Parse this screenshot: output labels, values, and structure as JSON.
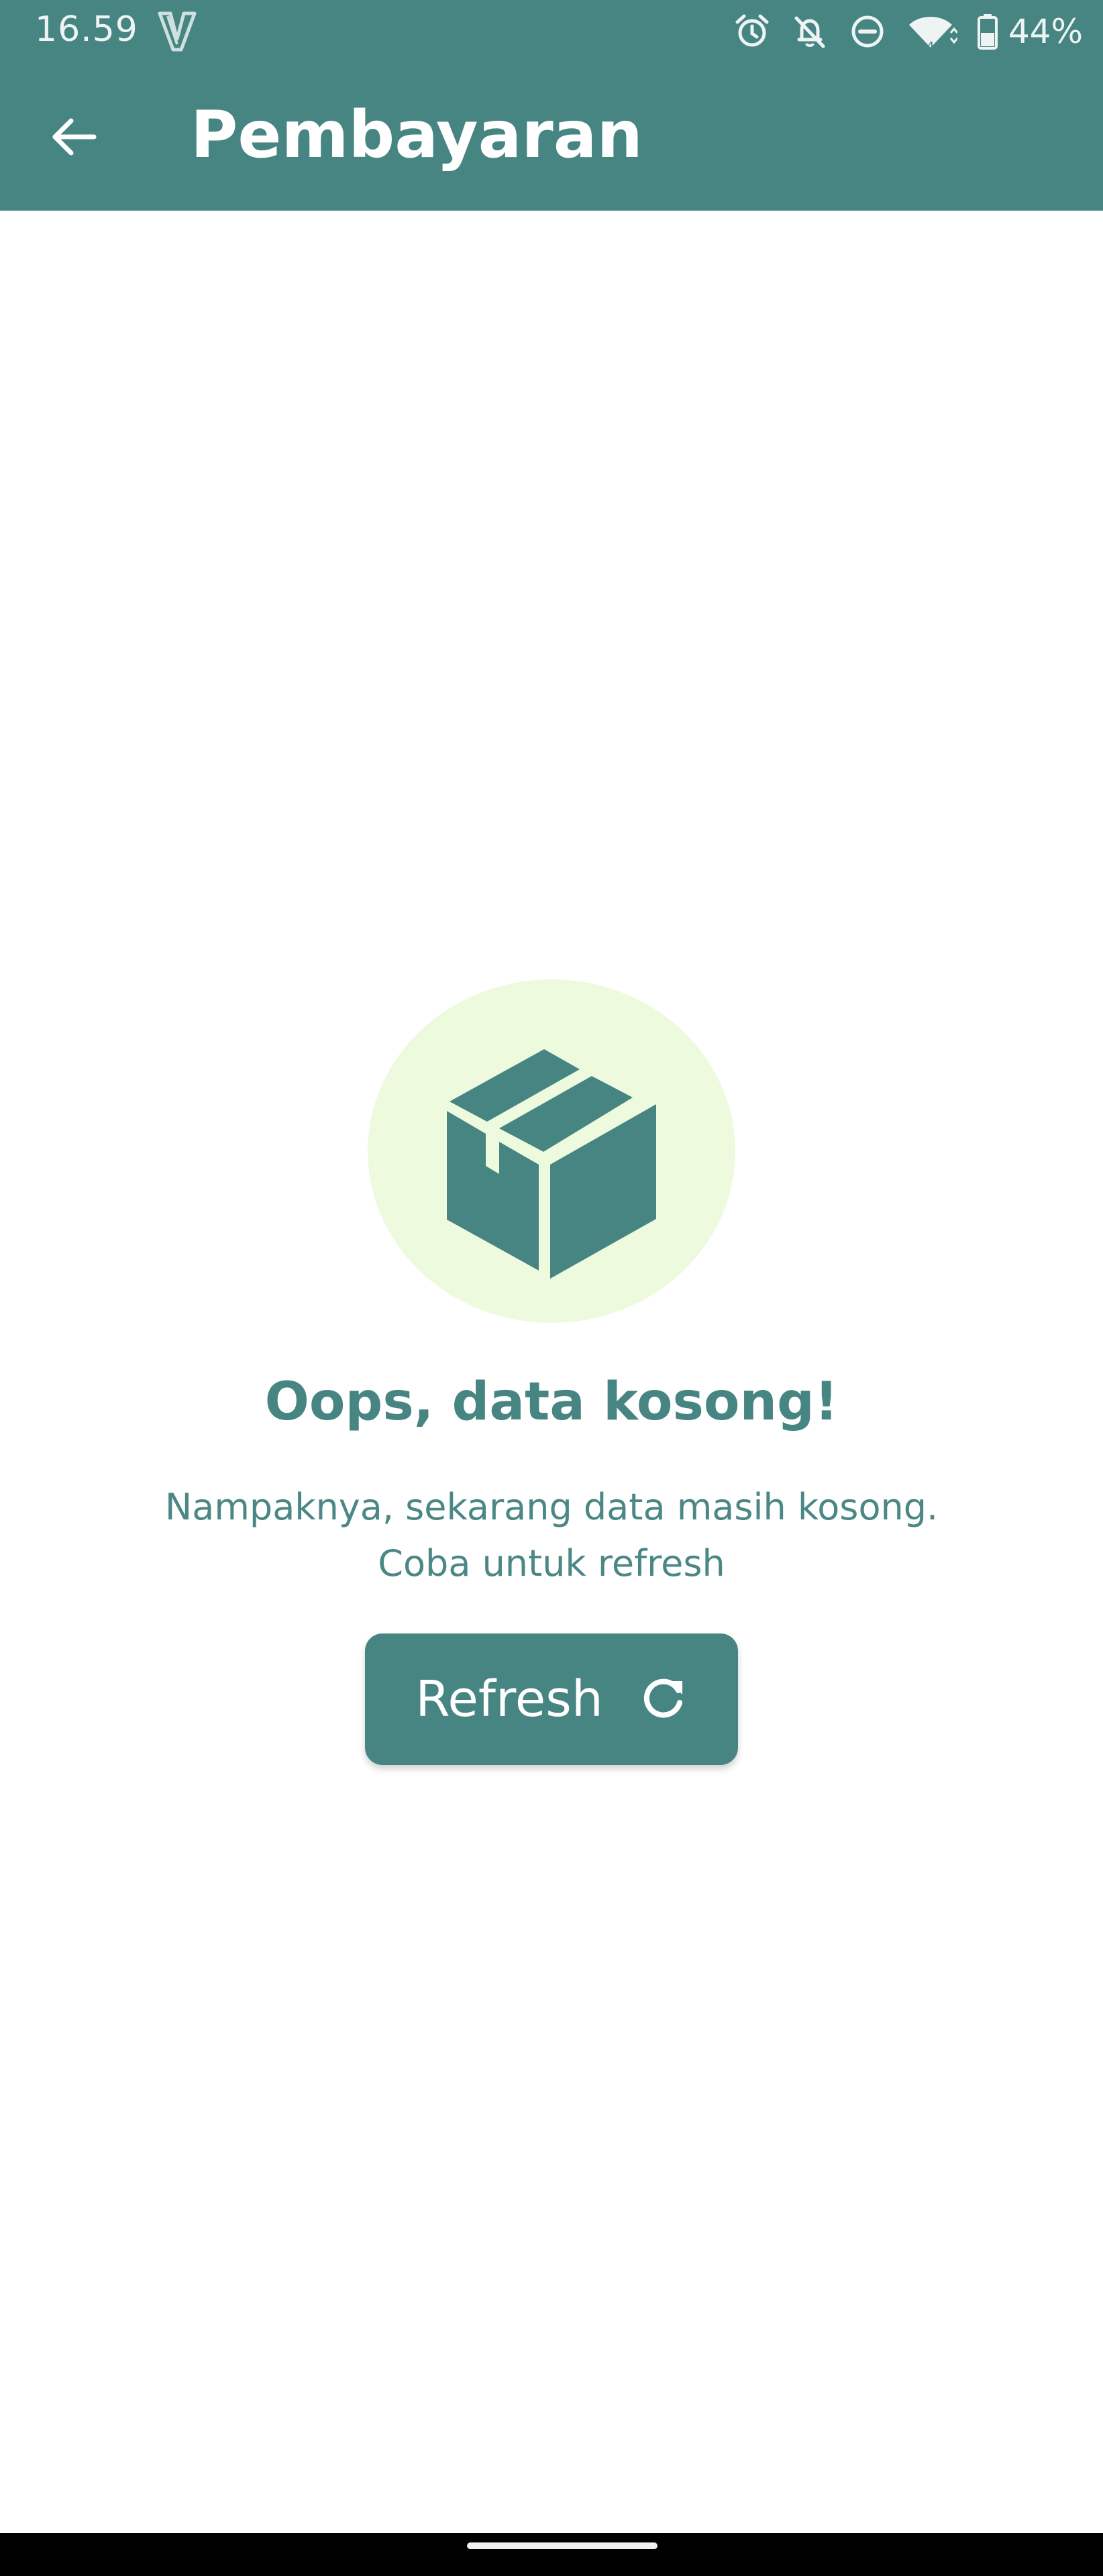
{
  "status_bar": {
    "time": "16.59",
    "battery": "44%",
    "icons": [
      "v-logo-icon",
      "alarm-icon",
      "notifications-off-icon",
      "do-not-disturb-icon",
      "wifi-icon",
      "battery-icon"
    ]
  },
  "app_bar": {
    "title": "Pembayaran",
    "back_icon": "arrow-back-icon"
  },
  "empty_state": {
    "illustration_icon": "package-box-icon",
    "title": "Oops, data kosong!",
    "description_line1": "Nampaknya, sekarang data masih kosong.",
    "description_line2": "Coba untuk refresh",
    "refresh_label": "Refresh",
    "refresh_icon": "refresh-icon"
  },
  "colors": {
    "primary": "#478583",
    "illustration_bg": "#edfadd",
    "background": "#ffffff",
    "nav_bar": "#000000"
  }
}
